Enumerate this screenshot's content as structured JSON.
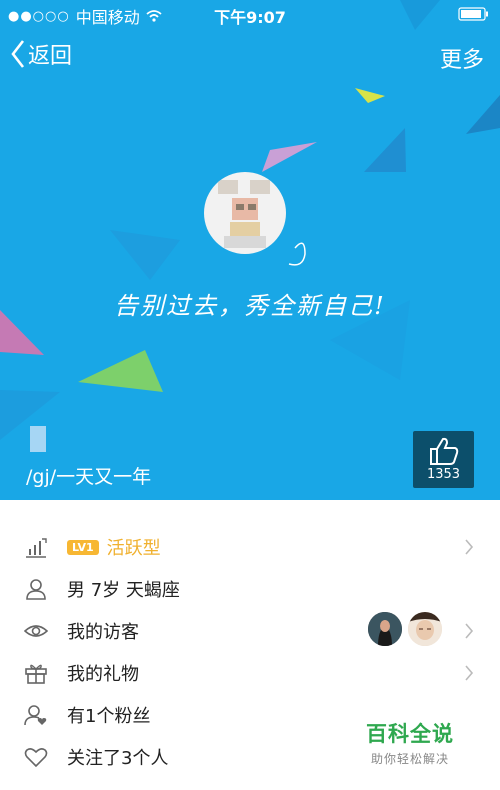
{
  "status_bar": {
    "signal_dots": "●●○○○",
    "carrier": "中国移动",
    "wifi_icon": "wifi-icon",
    "time": "下午9:07",
    "battery_icon": "battery-icon"
  },
  "nav": {
    "back_label": "返回",
    "more_label": "更多"
  },
  "profile": {
    "tagline": "告别过去，秀全新自己!",
    "signature": "/gj/一天又一年",
    "likes": "1353"
  },
  "info_list": [
    {
      "icon": "level-chart-icon",
      "badge": "LV1",
      "label": "活跃型",
      "chevron": true
    },
    {
      "icon": "user-icon",
      "label": "男  7岁  天蝎座",
      "chevron": false
    },
    {
      "icon": "eye-icon",
      "label": "我的访客",
      "chevron": true
    },
    {
      "icon": "gift-icon",
      "label": "我的礼物",
      "chevron": true
    },
    {
      "icon": "fans-icon",
      "label": "有1个粉丝",
      "chevron": false
    },
    {
      "icon": "heart-icon",
      "label": "关注了3个人",
      "chevron": false
    }
  ],
  "watermark": {
    "title": "百科全说",
    "subtitle": "助你轻松解决"
  },
  "colors": {
    "hero_bg": "#19a7e6",
    "like_box": "#0c4f6b",
    "level_accent": "#f0b12f",
    "watermark_green": "#2fa84f"
  }
}
